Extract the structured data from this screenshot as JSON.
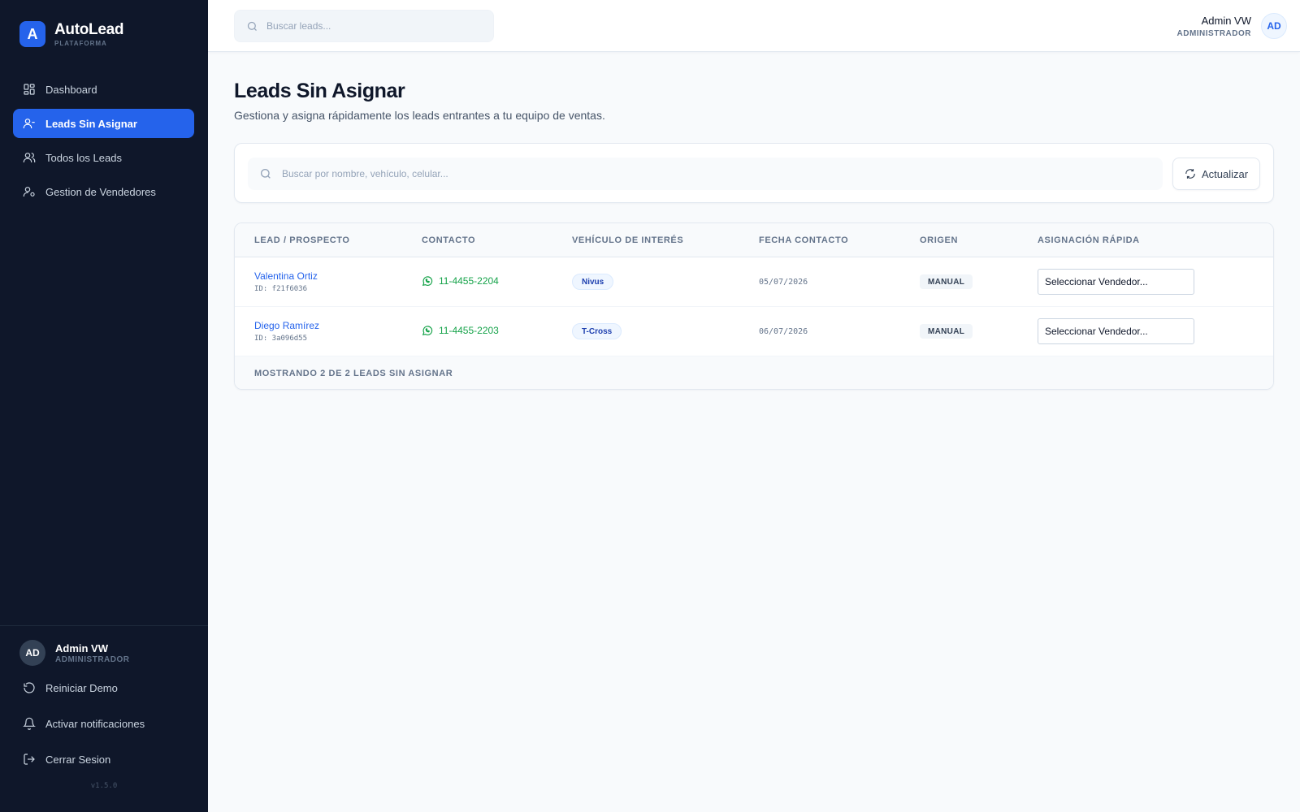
{
  "brand": {
    "logo_letter": "A",
    "name": "AutoLead",
    "subtitle": "PLATAFORMA",
    "accent_color": "#2563eb"
  },
  "sidebar": {
    "items": [
      {
        "label": "Dashboard",
        "icon": "dashboard-icon",
        "active": false
      },
      {
        "label": "Leads Sin Asignar",
        "icon": "user-minus-icon",
        "active": true
      },
      {
        "label": "Todos los Leads",
        "icon": "users-icon",
        "active": false
      },
      {
        "label": "Gestion de Vendedores",
        "icon": "user-gear-icon",
        "active": false
      }
    ],
    "user": {
      "initials": "AD",
      "name": "Admin VW",
      "role": "ADMINISTRADOR"
    },
    "actions": [
      {
        "label": "Reiniciar Demo",
        "icon": "reset-icon"
      },
      {
        "label": "Activar notificaciones",
        "icon": "bell-icon"
      },
      {
        "label": "Cerrar Sesion",
        "icon": "logout-icon"
      }
    ],
    "version": "v1.5.0"
  },
  "header": {
    "search_placeholder": "Buscar leads...",
    "user": {
      "name": "Admin VW",
      "role": "ADMINISTRADOR",
      "initials": "AD"
    }
  },
  "main": {
    "title": "Leads Sin Asignar",
    "subtitle": "Gestiona y asigna rápidamente los leads entrantes a tu equipo de ventas.",
    "filter": {
      "search_placeholder": "Buscar por nombre, vehículo, celular...",
      "refresh_label": "Actualizar"
    },
    "table": {
      "columns": [
        "LEAD / PROSPECTO",
        "CONTACTO",
        "VEHÍCULO DE INTERÉS",
        "FECHA CONTACTO",
        "ORIGEN",
        "ASIGNACIÓN RÁPIDA"
      ],
      "rows": [
        {
          "name": "Valentina Ortiz",
          "id": "ID: f21f6036",
          "phone": "11-4455-2204",
          "vehicle": "Nivus",
          "date": "05/07/2026",
          "origin": "MANUAL",
          "assign": "Seleccionar Vendedor..."
        },
        {
          "name": "Diego Ramírez",
          "id": "ID: 3a096d55",
          "phone": "11-4455-2203",
          "vehicle": "T-Cross",
          "date": "06/07/2026",
          "origin": "MANUAL",
          "assign": "Seleccionar Vendedor..."
        }
      ],
      "footer": "MOSTRANDO 2 DE 2 LEADS SIN ASIGNAR"
    }
  }
}
